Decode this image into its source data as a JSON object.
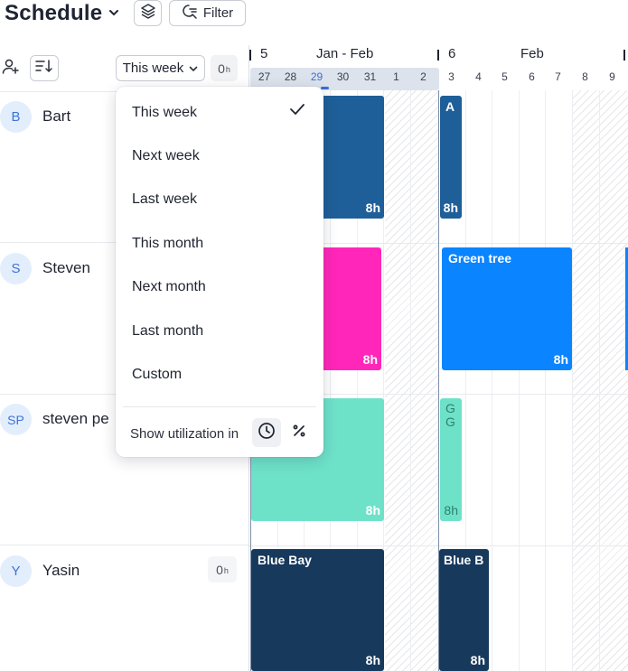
{
  "header": {
    "title": "Schedule",
    "filter_label": "Filter"
  },
  "toolbar": {
    "week_select_value": "This week",
    "utilization_value": "0",
    "utilization_unit": "h"
  },
  "people": [
    {
      "initials": "B",
      "name": "Bart"
    },
    {
      "initials": "S",
      "name": "Steven"
    },
    {
      "initials": "SP",
      "name": "steven pe"
    },
    {
      "initials": "Y",
      "name": "Yasin",
      "hours": "0",
      "hours_unit": "h"
    }
  ],
  "timeline": {
    "weeks": [
      {
        "number": "5",
        "month": "Jan - Feb"
      },
      {
        "number": "6",
        "month": "Feb"
      }
    ],
    "days": [
      "27",
      "28",
      "29",
      "30",
      "31",
      "1",
      "2",
      "3",
      "4",
      "5",
      "6",
      "7",
      "8",
      "9"
    ],
    "today": "29"
  },
  "blocks": [
    {
      "label": "",
      "hours": "8h",
      "color": "#1f5f99"
    },
    {
      "label": "A",
      "hours": "8h",
      "color": "#1f5f99"
    },
    {
      "label": "",
      "hours": "8h",
      "color": "#ff26b9"
    },
    {
      "label": "Green tree",
      "hours": "8h",
      "color": "#0a84ff"
    },
    {
      "label": "",
      "hours": "8h",
      "color": "#6ee2c9"
    },
    {
      "label": "G\nG",
      "hours": "8h",
      "color": "#6ee2c9"
    },
    {
      "label": "Blue Bay",
      "hours": "8h",
      "color": "#17395c"
    },
    {
      "label": "Blue B",
      "hours": "8h",
      "color": "#17395c"
    }
  ],
  "dropdown": {
    "options": [
      "This week",
      "Next week",
      "Last week",
      "This month",
      "Next month",
      "Last month",
      "Custom"
    ],
    "selected": "This week",
    "utilization_label": "Show utilization in"
  },
  "icons": [
    "chevron-down-icon",
    "layers-icon",
    "filter-search-icon",
    "add-user-icon",
    "sort-icon",
    "check-icon",
    "clock-icon",
    "percent-icon"
  ]
}
